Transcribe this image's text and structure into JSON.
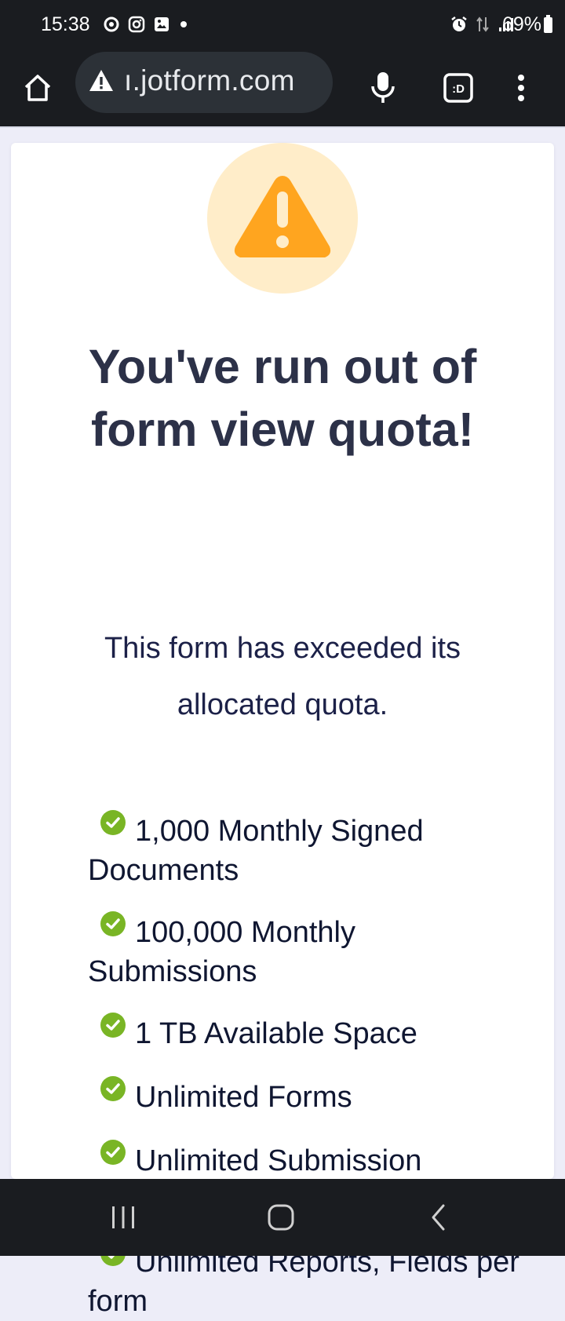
{
  "status_bar": {
    "time": "15:38",
    "battery": "69%",
    "left_icons": [
      "sync-icon",
      "instagram-icon",
      "gallery-icon",
      "dot-icon"
    ],
    "right_icons": [
      "alarm-icon",
      "data-arrows-icon",
      "signal-icon"
    ]
  },
  "browser": {
    "url": "ı.jotform.com",
    "icons": [
      "home-icon",
      "warning-icon",
      "mic-icon",
      "tab-switcher-icon",
      "more-icon"
    ],
    "tab_label": ":D"
  },
  "page": {
    "title": "You've run out of form view quota!",
    "subtitle": "This form has exceeded its allocated quota.",
    "features": [
      "1,000 Monthly Signed Documents",
      "100,000 Monthly Submissions",
      "1 TB Available Space",
      "Unlimited Forms",
      "Unlimited Submission Storage",
      "Unlimited Reports, Fields per form"
    ]
  },
  "colors": {
    "warning_bg": "#ffedc9",
    "warning_icon": "#ffa51f",
    "check": "#79b525",
    "title": "#2c3148",
    "bars": "#1a1c20"
  },
  "nav_bar": {
    "icons": [
      "recents-icon",
      "home-circle-icon",
      "back-icon"
    ]
  }
}
